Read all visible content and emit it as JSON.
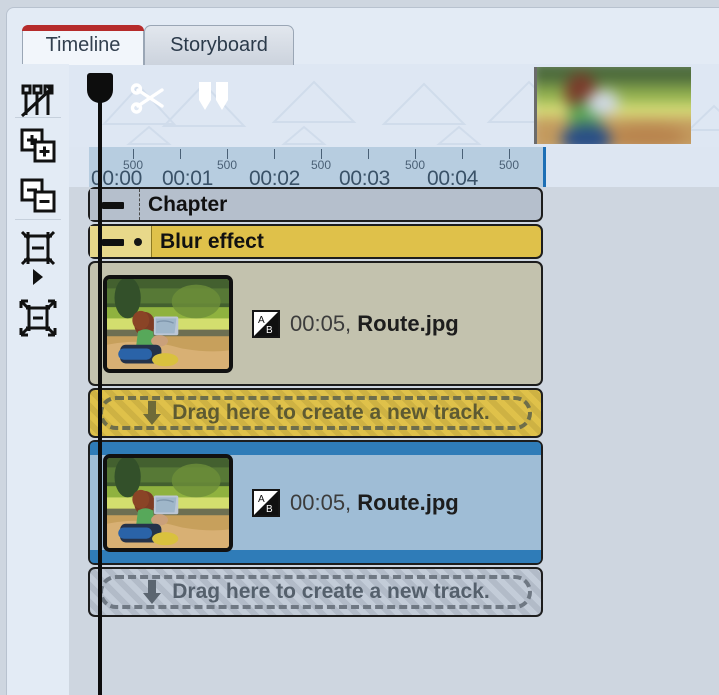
{
  "window": {
    "accent_red": "#b62b2b",
    "panel_bg": "#e3ebf5"
  },
  "tabs": [
    {
      "label": "Timeline",
      "active": true,
      "name": "tab-timeline"
    },
    {
      "label": "Storyboard",
      "active": false,
      "name": "tab-storyboard"
    }
  ],
  "sidebar": {
    "items": [
      {
        "icon": "split-clips-icon",
        "label": "Split clips"
      },
      {
        "icon": "add-track-icon",
        "label": "Add track"
      },
      {
        "icon": "remove-track-icon",
        "label": "Remove track"
      },
      {
        "icon": "fit-track-height-icon",
        "label": "Fit track height"
      },
      {
        "icon": "expand-arrow-icon",
        "label": "Expand"
      },
      {
        "icon": "fit-timeline-icon",
        "label": "Fit timeline"
      }
    ]
  },
  "toolbar": {
    "items": [
      {
        "icon": "scissors-icon",
        "label": "Cut"
      },
      {
        "icon": "split-marker-icon",
        "label": "Split"
      }
    ]
  },
  "ruler": {
    "second_labels": [
      "00:00",
      "00:01",
      "00:02",
      "00:03",
      "00:04"
    ],
    "half_label": "500",
    "half_labels": [
      "500",
      "500",
      "500",
      "500",
      "500"
    ],
    "marker_color": "#1d6fb5"
  },
  "tracks": [
    {
      "type": "chapter",
      "name": "track-chapter",
      "label": "Chapter",
      "collapse_icon": "minus-icon"
    },
    {
      "type": "effect",
      "name": "track-blur-effect",
      "label": "Blur effect",
      "collapse_icon": "minus-icon",
      "keyframe_icon": "dot-icon",
      "color": "#dfc14a"
    },
    {
      "type": "clip",
      "name": "track-clip-beige",
      "color": "#c3c2ae",
      "clip": {
        "transition_icon": "ab-transition-icon",
        "duration": "00:05,",
        "filename": "Route.jpg",
        "thumbnail": "photo-hiker-reading-map"
      }
    },
    {
      "type": "dropzone",
      "name": "dropzone-yellow",
      "label": "Drag here to create a new track.",
      "icon": "down-arrow-icon",
      "color": "#dfc14a"
    },
    {
      "type": "clip",
      "name": "track-clip-blue",
      "color": "#9fbdd6",
      "clip": {
        "transition_icon": "ab-transition-icon",
        "duration": "00:05,",
        "filename": "Route.jpg",
        "thumbnail": "photo-hiker-reading-map"
      }
    },
    {
      "type": "dropzone",
      "name": "dropzone-gray",
      "label": "Drag here to create a new track.",
      "icon": "down-arrow-icon",
      "color": "#c3ccd8"
    }
  ],
  "playhead": {
    "name": "playhead",
    "position_label": "00:00"
  }
}
